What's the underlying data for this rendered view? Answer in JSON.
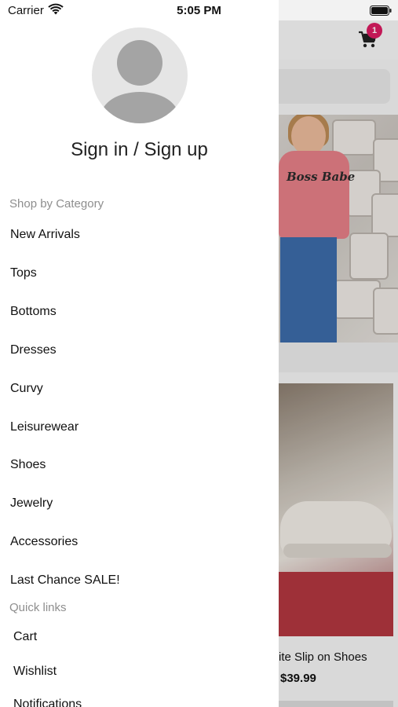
{
  "status_bar": {
    "carrier": "Carrier",
    "time": "5:05 PM"
  },
  "drawer": {
    "sign_in_label": "Sign in / Sign up",
    "shop_section_title": "Shop by Category",
    "categories": [
      "New Arrivals",
      "Tops",
      "Bottoms",
      "Dresses",
      "Curvy",
      "Leisurewear",
      "Shoes",
      "Jewelry",
      "Accessories",
      "Last Chance SALE!"
    ],
    "quick_links_title": "Quick links",
    "quick_links": [
      "Cart",
      "Wishlist",
      "Notifications"
    ]
  },
  "background_app": {
    "cart_badge_count": "1",
    "product_name": "ite Slip on Shoes",
    "product_price": "$39.99",
    "shirt_print": "Boss Babe"
  },
  "colors": {
    "badge": "#d81b60",
    "avatar_bg": "#e5e5e5",
    "section_title": "#8e8e8e"
  },
  "icons": [
    "wifi-icon",
    "battery-icon",
    "cart-icon",
    "avatar-icon"
  ]
}
